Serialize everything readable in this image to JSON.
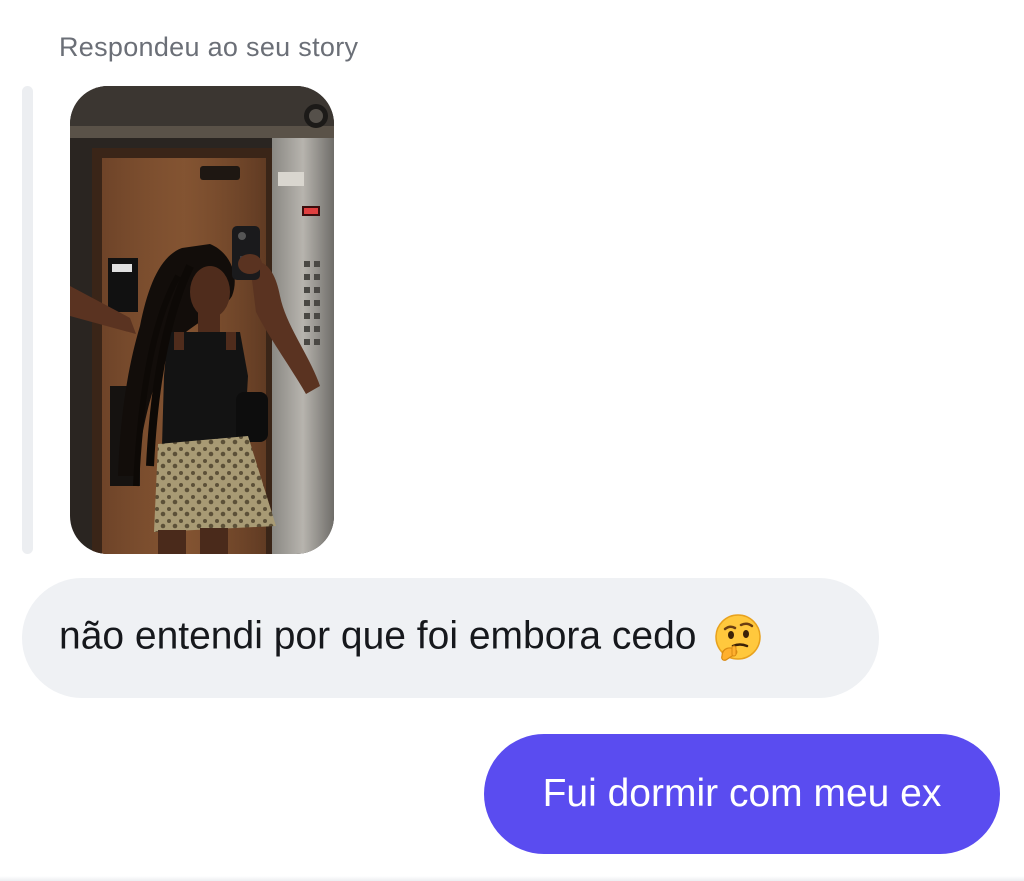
{
  "thread": {
    "reply_label": "Respondeu ao seu story",
    "story_thumbnail": {
      "alt": "Story: woman taking a mirror selfie in an elevator",
      "icon": "story-photo"
    },
    "messages": [
      {
        "direction": "incoming",
        "text": "não entendi por que foi embora cedo",
        "emoji": "🤔",
        "emoji_icon": "thinking-face-icon"
      },
      {
        "direction": "outgoing",
        "text": "Fui dormir com meu ex"
      }
    ]
  },
  "colors": {
    "incoming_bubble": "#eff1f4",
    "outgoing_bubble": "#5a4cf0",
    "label_text": "#6b6f77",
    "quote_bar": "#eceef1"
  }
}
